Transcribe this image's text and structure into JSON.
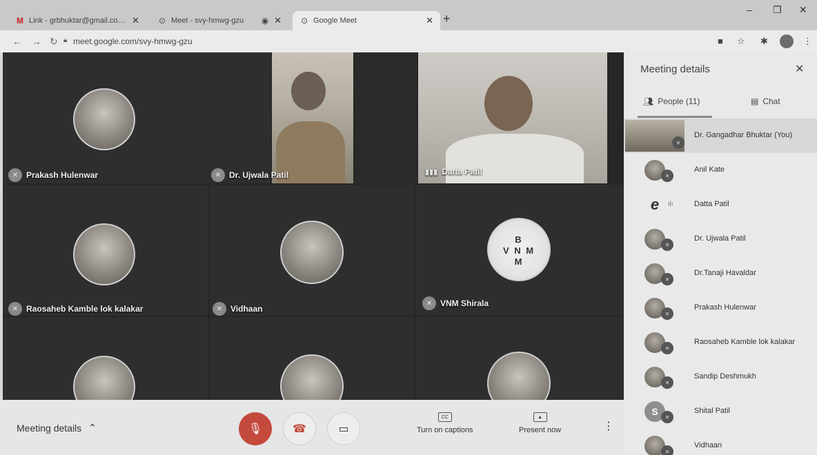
{
  "browser": {
    "tabs": [
      {
        "label": "Link - grbhuktar@gmail.com - G",
        "icon": "gmail-icon"
      },
      {
        "label": "Meet - svy-hmwg-gzu",
        "icon": "meet-icon"
      },
      {
        "label": "Google Meet",
        "icon": "meet-icon"
      }
    ],
    "new_tab": "+",
    "url": "meet.google.com/svy-hmwg-gzu"
  },
  "grid": {
    "tiles": [
      {
        "name": "Prakash Hulenwar",
        "muted": true
      },
      {
        "name": "Dr. Ujwala Patil",
        "muted": true
      },
      {
        "name": "Datta Patil",
        "speaking": true
      },
      {
        "name": "Raosaheb Kamble lok kalakar",
        "muted": true
      },
      {
        "name": "Vidhaan",
        "muted": true
      },
      {
        "name": "VNM Shirala",
        "muted": true
      }
    ],
    "badge_text": "B\nV N M\nM"
  },
  "bottom": {
    "meeting_details": "Meeting details",
    "captions_label": "Turn on captions",
    "captions_icon": "CC",
    "present_label": "Present now"
  },
  "panel": {
    "title": "Meeting details",
    "people_tab": "People (11)",
    "chat_tab": "Chat",
    "people": [
      {
        "name": "Dr. Gangadhar Bhuktar (You)",
        "avatar": "video"
      },
      {
        "name": "Anil Kate",
        "avatar": "photo"
      },
      {
        "name": "Datta Patil",
        "avatar": "logo",
        "logo_text": "e"
      },
      {
        "name": "Dr. Ujwala Patil",
        "avatar": "photo"
      },
      {
        "name": "Dr.Tanaji Havaldar",
        "avatar": "photo"
      },
      {
        "name": "Prakash Hulenwar",
        "avatar": "photo"
      },
      {
        "name": "Raosaheb Kamble lok kalakar",
        "avatar": "photo"
      },
      {
        "name": "Sandip Deshmukh",
        "avatar": "photo"
      },
      {
        "name": "Shital Patil",
        "avatar": "letter",
        "letter": "S"
      },
      {
        "name": "Vidhaan",
        "avatar": "photo"
      }
    ]
  },
  "colors": {
    "grid_bg": "#262626",
    "end_call_red": "#c44a3d",
    "panel_bg": "#e9e9e9"
  }
}
